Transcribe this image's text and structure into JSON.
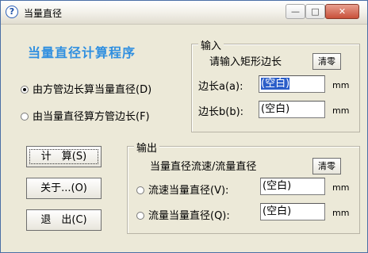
{
  "window": {
    "title": "当量直径",
    "icon": "question-mark-icon"
  },
  "titlebar_buttons": {
    "minimize": "—",
    "maximize": "□",
    "close": "✕"
  },
  "app_title": "当量直径计算程序",
  "modes": [
    {
      "label": "由方管边长算当量直径(D)",
      "selected": true
    },
    {
      "label": "由当量直径算方管边长(F)",
      "selected": false
    }
  ],
  "input_group": {
    "title": "输入",
    "prompt": "请输入矩形边长",
    "clear_label": "清零",
    "side_a_label": "边长a(a):",
    "side_a_value": "(空白)",
    "side_b_label": "边长b(b):",
    "side_b_value": "(空白)",
    "unit": "mm"
  },
  "output_group": {
    "title": "输出",
    "subtitle": "当量直径流速/流量直径",
    "clear_label": "清零",
    "velocity_label": "流速当量直径(V):",
    "velocity_value": "(空白)",
    "flow_label": "流量当量直径(Q):",
    "flow_value": "(空白)",
    "unit": "mm"
  },
  "buttons": {
    "calculate": "计　算(S)",
    "about": "关于...(O)",
    "exit": "退　出(C)"
  }
}
